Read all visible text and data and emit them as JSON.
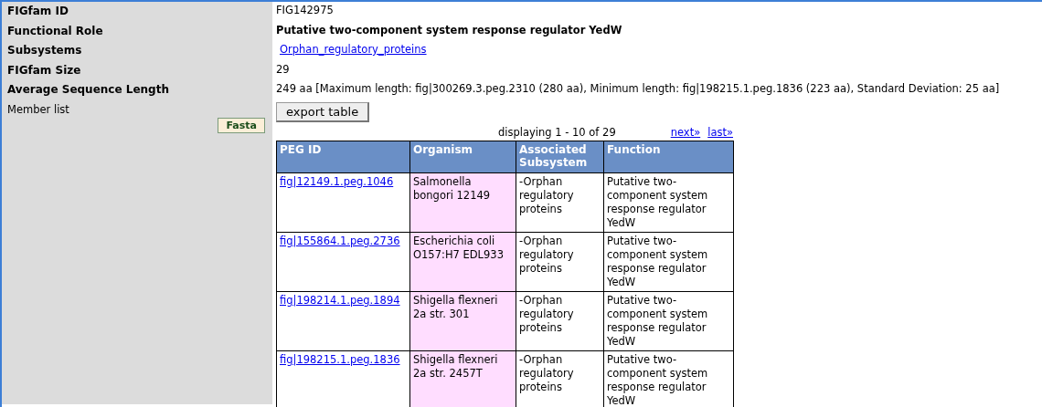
{
  "fields": [
    {
      "label": "FIGfam ID",
      "kind": "text",
      "value": "FIG142975"
    },
    {
      "label": "Functional Role",
      "kind": "bold",
      "value": "Putative two-component system response regulator YedW"
    },
    {
      "label": "Subsystems",
      "kind": "link",
      "value": "Orphan_regulatory_proteins"
    },
    {
      "label": "FIGfam Size",
      "kind": "text",
      "value": "29"
    },
    {
      "label": "Average Sequence Length",
      "kind": "text",
      "value": "249 aa [Maximum length: fig|300269.3.peg.2310 (280 aa), Minimum length: fig|198215.1.peg.1836 (223 aa), Standard Deviation: 25 aa]"
    }
  ],
  "member_list": {
    "label": "Member list",
    "fasta_button": "Fasta",
    "export_button": "export table",
    "paging": {
      "text": "displaying 1 - 10 of 29",
      "next": "next»",
      "last": "last»"
    },
    "table": {
      "columns": [
        "PEG ID",
        "Organism",
        "Associated Subsystem",
        "Function"
      ],
      "rows": [
        {
          "peg_id": "fig|12149.1.peg.1046",
          "organism": "Salmonella bongori 12149",
          "subsystem": "-Orphan regulatory proteins",
          "function": "Putative two-component system response regulator YedW"
        },
        {
          "peg_id": "fig|155864.1.peg.2736",
          "organism": "Escherichia coli O157:H7 EDL933",
          "subsystem": "-Orphan regulatory proteins",
          "function": "Putative two-component system response regulator YedW"
        },
        {
          "peg_id": "fig|198214.1.peg.1894",
          "organism": "Shigella flexneri 2a str. 301",
          "subsystem": "-Orphan regulatory proteins",
          "function": "Putative two-component system response regulator YedW"
        },
        {
          "peg_id": "fig|198215.1.peg.1836",
          "organism": "Shigella flexneri 2a str. 2457T",
          "subsystem": "-Orphan regulatory proteins",
          "function": "Putative two-component system response regulator YedW"
        }
      ]
    }
  }
}
